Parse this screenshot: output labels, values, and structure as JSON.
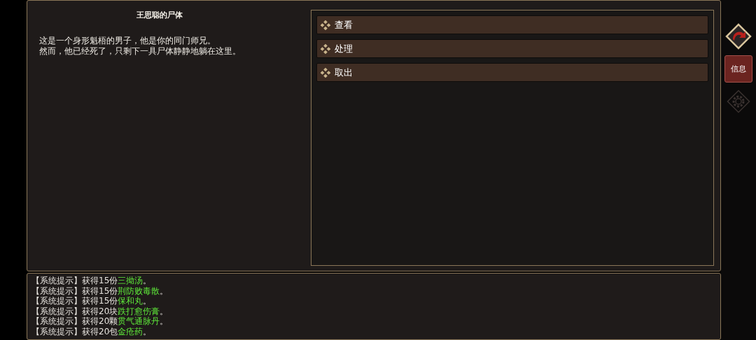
{
  "corpse": {
    "title": "王思聪的尸体",
    "description": [
      "这是一个身形魁梧的男子，他是你的同门师兄。",
      "然而，他已经死了，只剩下一具尸体静静地躺在这里。"
    ]
  },
  "actions": [
    {
      "label": "查看"
    },
    {
      "label": "处理"
    },
    {
      "label": "取出"
    }
  ],
  "sidebar": {
    "info_button": "信息"
  },
  "log": [
    {
      "prefix": "【系统提示】获得15份",
      "item": "三拗汤",
      "end": "。"
    },
    {
      "prefix": "【系统提示】获得15份",
      "item": "荆防败毒散",
      "end": "。"
    },
    {
      "prefix": "【系统提示】获得15份",
      "item": "保和丸",
      "end": "。"
    },
    {
      "prefix": "【系统提示】获得20块",
      "item": "跌打愈伤膏",
      "end": "。"
    },
    {
      "prefix": "【系统提示】获得20颗",
      "item": "贯气通脉丹",
      "end": "。"
    },
    {
      "prefix": "【系统提示】获得20包",
      "item": "金疮药",
      "end": "。"
    }
  ]
}
